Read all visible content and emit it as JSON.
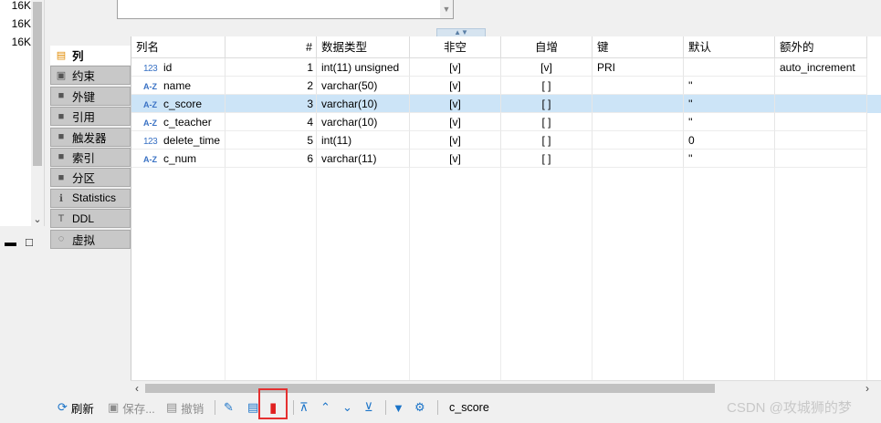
{
  "left_panel": {
    "sizes": [
      "16K",
      "16K",
      "16K"
    ]
  },
  "tabs": [
    {
      "label": "列",
      "icon": "columns-icon",
      "active": true
    },
    {
      "label": "约束",
      "icon": "constraint-icon",
      "active": false
    },
    {
      "label": "外键",
      "icon": "folder-icon",
      "active": false
    },
    {
      "label": "引用",
      "icon": "folder-icon",
      "active": false
    },
    {
      "label": "触发器",
      "icon": "folder-icon",
      "active": false
    },
    {
      "label": "索引",
      "icon": "folder-icon",
      "active": false
    },
    {
      "label": "分区",
      "icon": "folder-icon",
      "active": false
    },
    {
      "label": "Statistics",
      "icon": "info-icon",
      "active": false
    },
    {
      "label": "DDL",
      "icon": "ddl-icon",
      "active": false
    },
    {
      "label": "虚拟",
      "icon": "virtual-icon",
      "active": false
    }
  ],
  "grid": {
    "headers": [
      "列名",
      "#",
      "数据类型",
      "非空",
      "自增",
      "键",
      "默认",
      "额外的"
    ],
    "rows": [
      {
        "type": "123",
        "name": "id",
        "num": "1",
        "datatype": "int(11) unsigned",
        "notnull": "[v]",
        "autoinc": "[v]",
        "key": "PRI",
        "default": "",
        "extra": "auto_increment"
      },
      {
        "type": "A-Z",
        "name": "name",
        "num": "2",
        "datatype": "varchar(50)",
        "notnull": "[v]",
        "autoinc": "[ ]",
        "key": "",
        "default": "''",
        "extra": ""
      },
      {
        "type": "A-Z",
        "name": "c_score",
        "num": "3",
        "datatype": "varchar(10)",
        "notnull": "[v]",
        "autoinc": "[ ]",
        "key": "",
        "default": "''",
        "extra": ""
      },
      {
        "type": "A-Z",
        "name": "c_teacher",
        "num": "4",
        "datatype": "varchar(10)",
        "notnull": "[v]",
        "autoinc": "[ ]",
        "key": "",
        "default": "''",
        "extra": ""
      },
      {
        "type": "123",
        "name": "delete_time",
        "num": "5",
        "datatype": "int(11)",
        "notnull": "[v]",
        "autoinc": "[ ]",
        "key": "",
        "default": "0",
        "extra": ""
      },
      {
        "type": "A-Z",
        "name": "c_num",
        "num": "6",
        "datatype": "varchar(11)",
        "notnull": "[v]",
        "autoinc": "[ ]",
        "key": "",
        "default": "''",
        "extra": ""
      }
    ],
    "selected_row": 2
  },
  "toolbar": {
    "refresh": "刷新",
    "save": "保存...",
    "undo": "撤销",
    "status": "c_score"
  },
  "colors": {
    "selection": "#cce4f7",
    "highlight_box": "#e53030",
    "delete_icon": "#e02020",
    "link_blue": "#1a73c8"
  },
  "watermark": "CSDN @攻城狮的梦"
}
